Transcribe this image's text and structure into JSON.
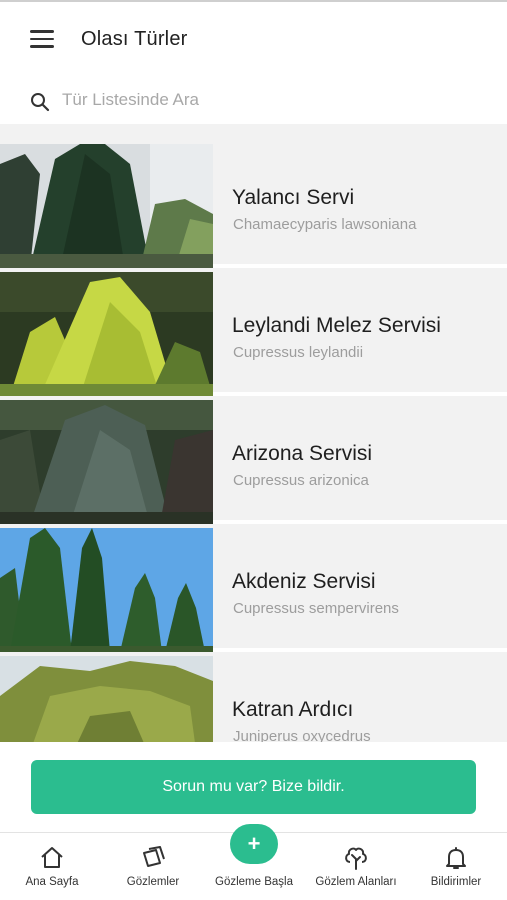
{
  "header": {
    "title": "Olası Türler",
    "menu_icon": "hamburger-menu-icon"
  },
  "search": {
    "placeholder": "Tür Listesinde Ara",
    "value": "",
    "icon": "search-icon"
  },
  "species": [
    {
      "name": "Yalancı Servi",
      "latin": "Chamaecyparis lawsoniana"
    },
    {
      "name": "Leylandi Melez Servisi",
      "latin": "Cupressus leylandii"
    },
    {
      "name": "Arizona Servisi",
      "latin": "Cupressus arizonica"
    },
    {
      "name": "Akdeniz Servisi",
      "latin": "Cupressus sempervirens"
    },
    {
      "name": "Katran Ardıcı",
      "latin": "Juniperus oxycedrus"
    }
  ],
  "report": {
    "label": "Sorun mu var? Bize bildir."
  },
  "bottom_nav": {
    "items": [
      {
        "label": "Ana Sayfa",
        "icon": "home-icon"
      },
      {
        "label": "Gözlemler",
        "icon": "observations-icon"
      },
      {
        "label": "Gözleme Başla",
        "icon": "plus-icon"
      },
      {
        "label": "Gözlem Alanları",
        "icon": "tree-icon"
      },
      {
        "label": "Bildirimler",
        "icon": "bell-icon"
      }
    ],
    "fab_symbol": "+"
  },
  "colors": {
    "accent": "#2bbd8f",
    "list_background": "#f2f2f2",
    "secondary_text": "#9d9d9d"
  }
}
